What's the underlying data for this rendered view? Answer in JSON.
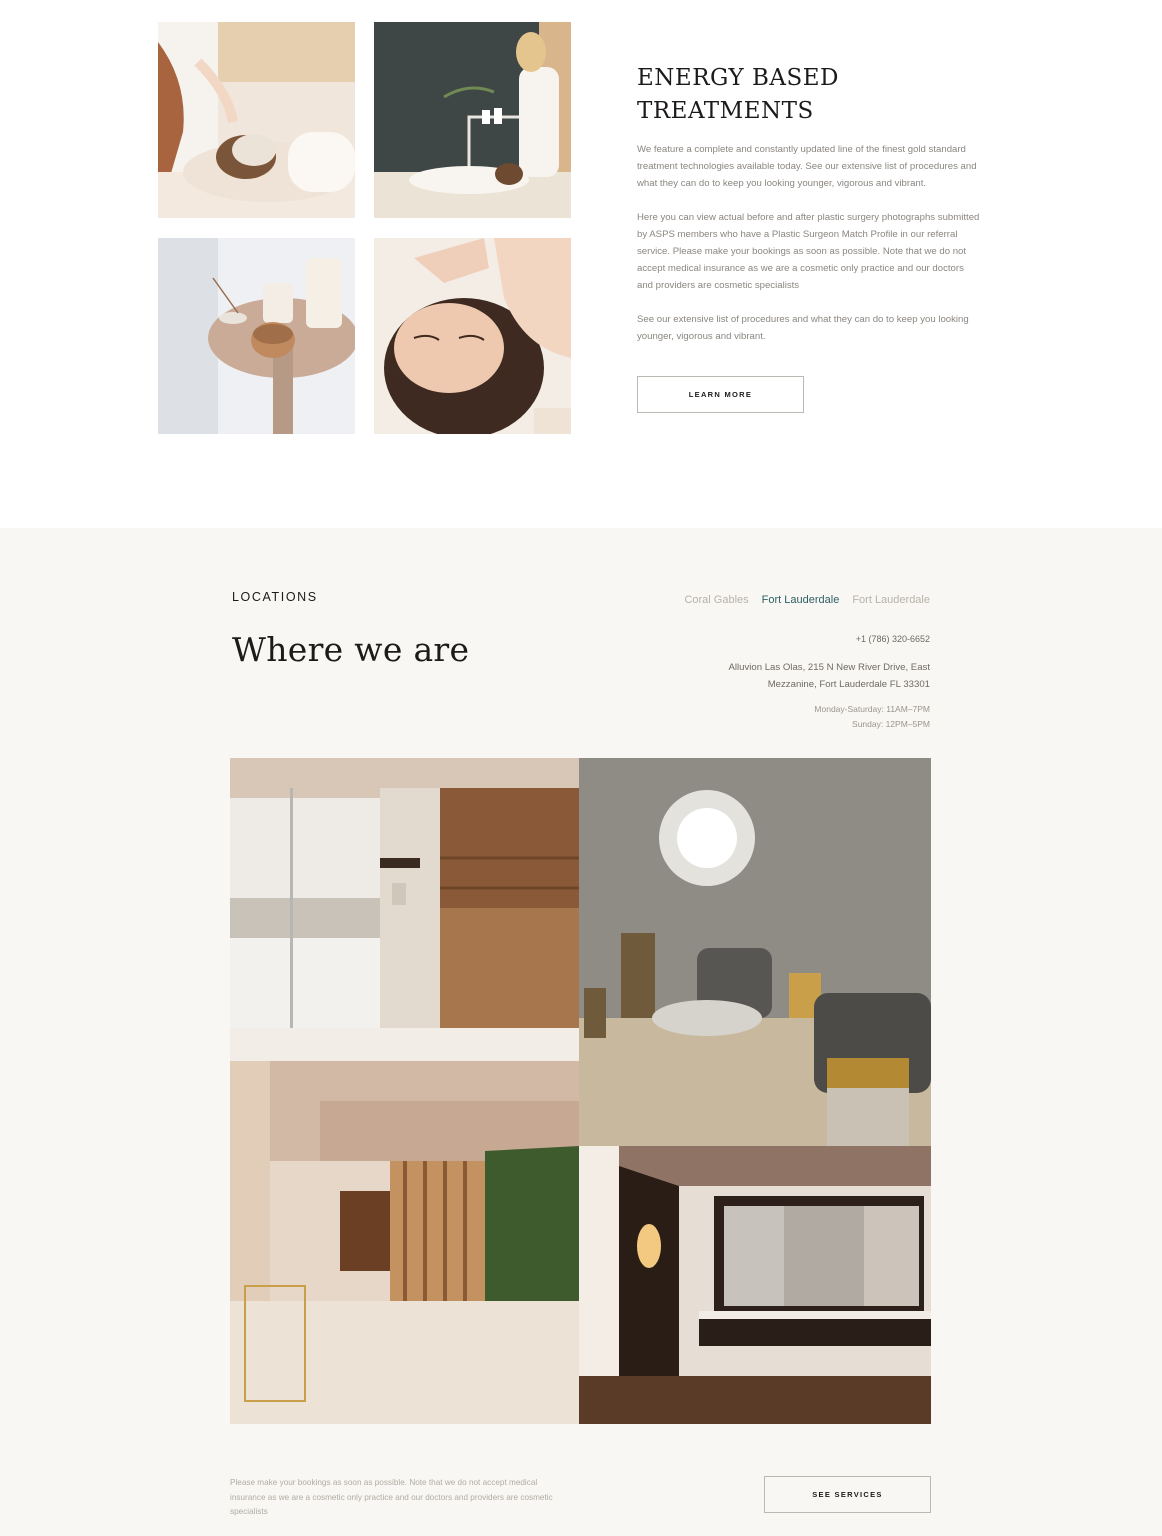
{
  "treatments": {
    "title": "Energy Based Treatments",
    "title_line1": "ENERGY BASED",
    "title_line2": "TREATMENTS",
    "paragraphs": [
      "We feature a complete and constantly updated line of the finest gold standard treatment technologies available today. See our extensive list of procedures and what they can do to keep you looking younger, vigorous and vibrant.",
      "Here you can view actual before and after plastic surgery photographs submitted by ASPS members who have a Plastic Surgeon Match Profile in our referral service. Please make your bookings as soon as possible. Note that we do not accept medical insurance as we are a cosmetic only practice and our doctors and providers are cosmetic specialists",
      "See our extensive list of procedures and what they can do to keep you looking younger, vigorous and vibrant."
    ],
    "button_label": "LEARN MORE",
    "images": [
      "facial-mask-photo",
      "therapist-photo",
      "candles-photo",
      "head-massage-photo"
    ]
  },
  "locations": {
    "eyebrow": "LOCATIONS",
    "title": "Where we are",
    "tabs": [
      {
        "label": "Coral Gables",
        "active": false
      },
      {
        "label": "Fort Lauderdale",
        "active": true
      },
      {
        "label": "Fort Lauderdale",
        "active": false
      }
    ],
    "phone": "+1 (786) 320-6652",
    "address": "Alluvion Las Olas, 215 N New River Drive, East Mezzanine, Fort Lauderdale FL 33301",
    "hours": [
      "Monday-Saturday:  11AM–7PM",
      "Sunday: 12PM–5PM"
    ],
    "images": [
      "steam-sauna-photo",
      "lounge-photo",
      "hallway-photo",
      "vanity-photo"
    ],
    "note": "Please make your bookings as soon as possible. Note that we do not accept medical insurance as we are a cosmetic only practice and our doctors and providers are cosmetic specialists",
    "button_label": "SEE SERVICES"
  },
  "colors": {
    "section_bg": "#f9f7f3",
    "heading": "#1d1b1a",
    "body_text": "#8b8680",
    "tab_active": "#2f5f66",
    "tab_inactive": "#b7b2ab"
  }
}
